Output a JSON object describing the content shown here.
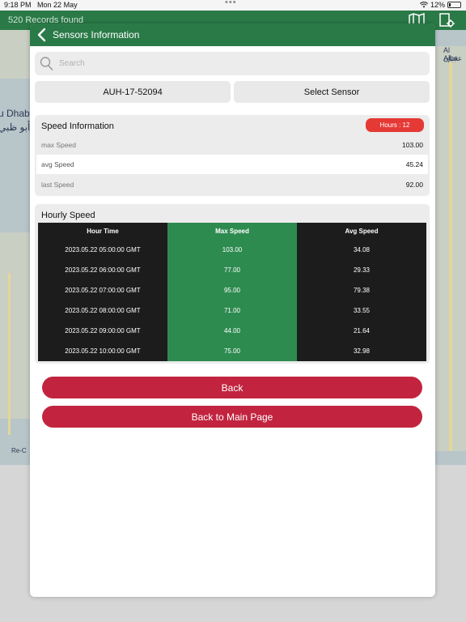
{
  "status_bar": {
    "time": "9:18 PM",
    "date": "Mon 22 May",
    "battery": "12%"
  },
  "app_header": {
    "records": "520 Records found",
    "icons": [
      "map-icon",
      "settings-location-icon"
    ]
  },
  "map": {
    "labels": [
      "Al Ajba",
      "عجبان",
      "u Dhab",
      "أبو ظبي",
      "Re-C"
    ]
  },
  "modal": {
    "title": "Sensors Information",
    "search_placeholder": "Search",
    "sensor_id": "AUH-17-52094",
    "select_sensor_label": "Select Sensor",
    "speed_info": {
      "title": "Speed Information",
      "hours_badge": "Hours : 12",
      "rows": [
        {
          "label": "max Speed",
          "value": "103.00"
        },
        {
          "label": "avg Speed",
          "value": "45.24"
        },
        {
          "label": "last Speed",
          "value": "92.00"
        }
      ]
    },
    "hourly": {
      "title": "Hourly Speed",
      "headers": [
        "Hour Time",
        "Max Speed",
        "Avg Speed"
      ],
      "rows": [
        [
          "2023.05.22  05:00:00 GMT",
          "103.00",
          "34.08"
        ],
        [
          "2023.05.22  06:00:00 GMT",
          "77.00",
          "29.33"
        ],
        [
          "2023.05.22  07:00:00 GMT",
          "95.00",
          "79.38"
        ],
        [
          "2023.05.22  08:00:00 GMT",
          "71.00",
          "33.55"
        ],
        [
          "2023.05.22  09:00:00 GMT",
          "44.00",
          "21.64"
        ],
        [
          "2023.05.22  10:00:00 GMT",
          "75.00",
          "32.98"
        ]
      ]
    },
    "back_label": "Back",
    "main_page_label": "Back to Main Page"
  },
  "colors": {
    "brand_green": "#2a7a47",
    "badge_red": "#e53935",
    "button_red": "#c2243f",
    "table_dark": "#1c1c1c",
    "table_green": "#2e8b50"
  }
}
